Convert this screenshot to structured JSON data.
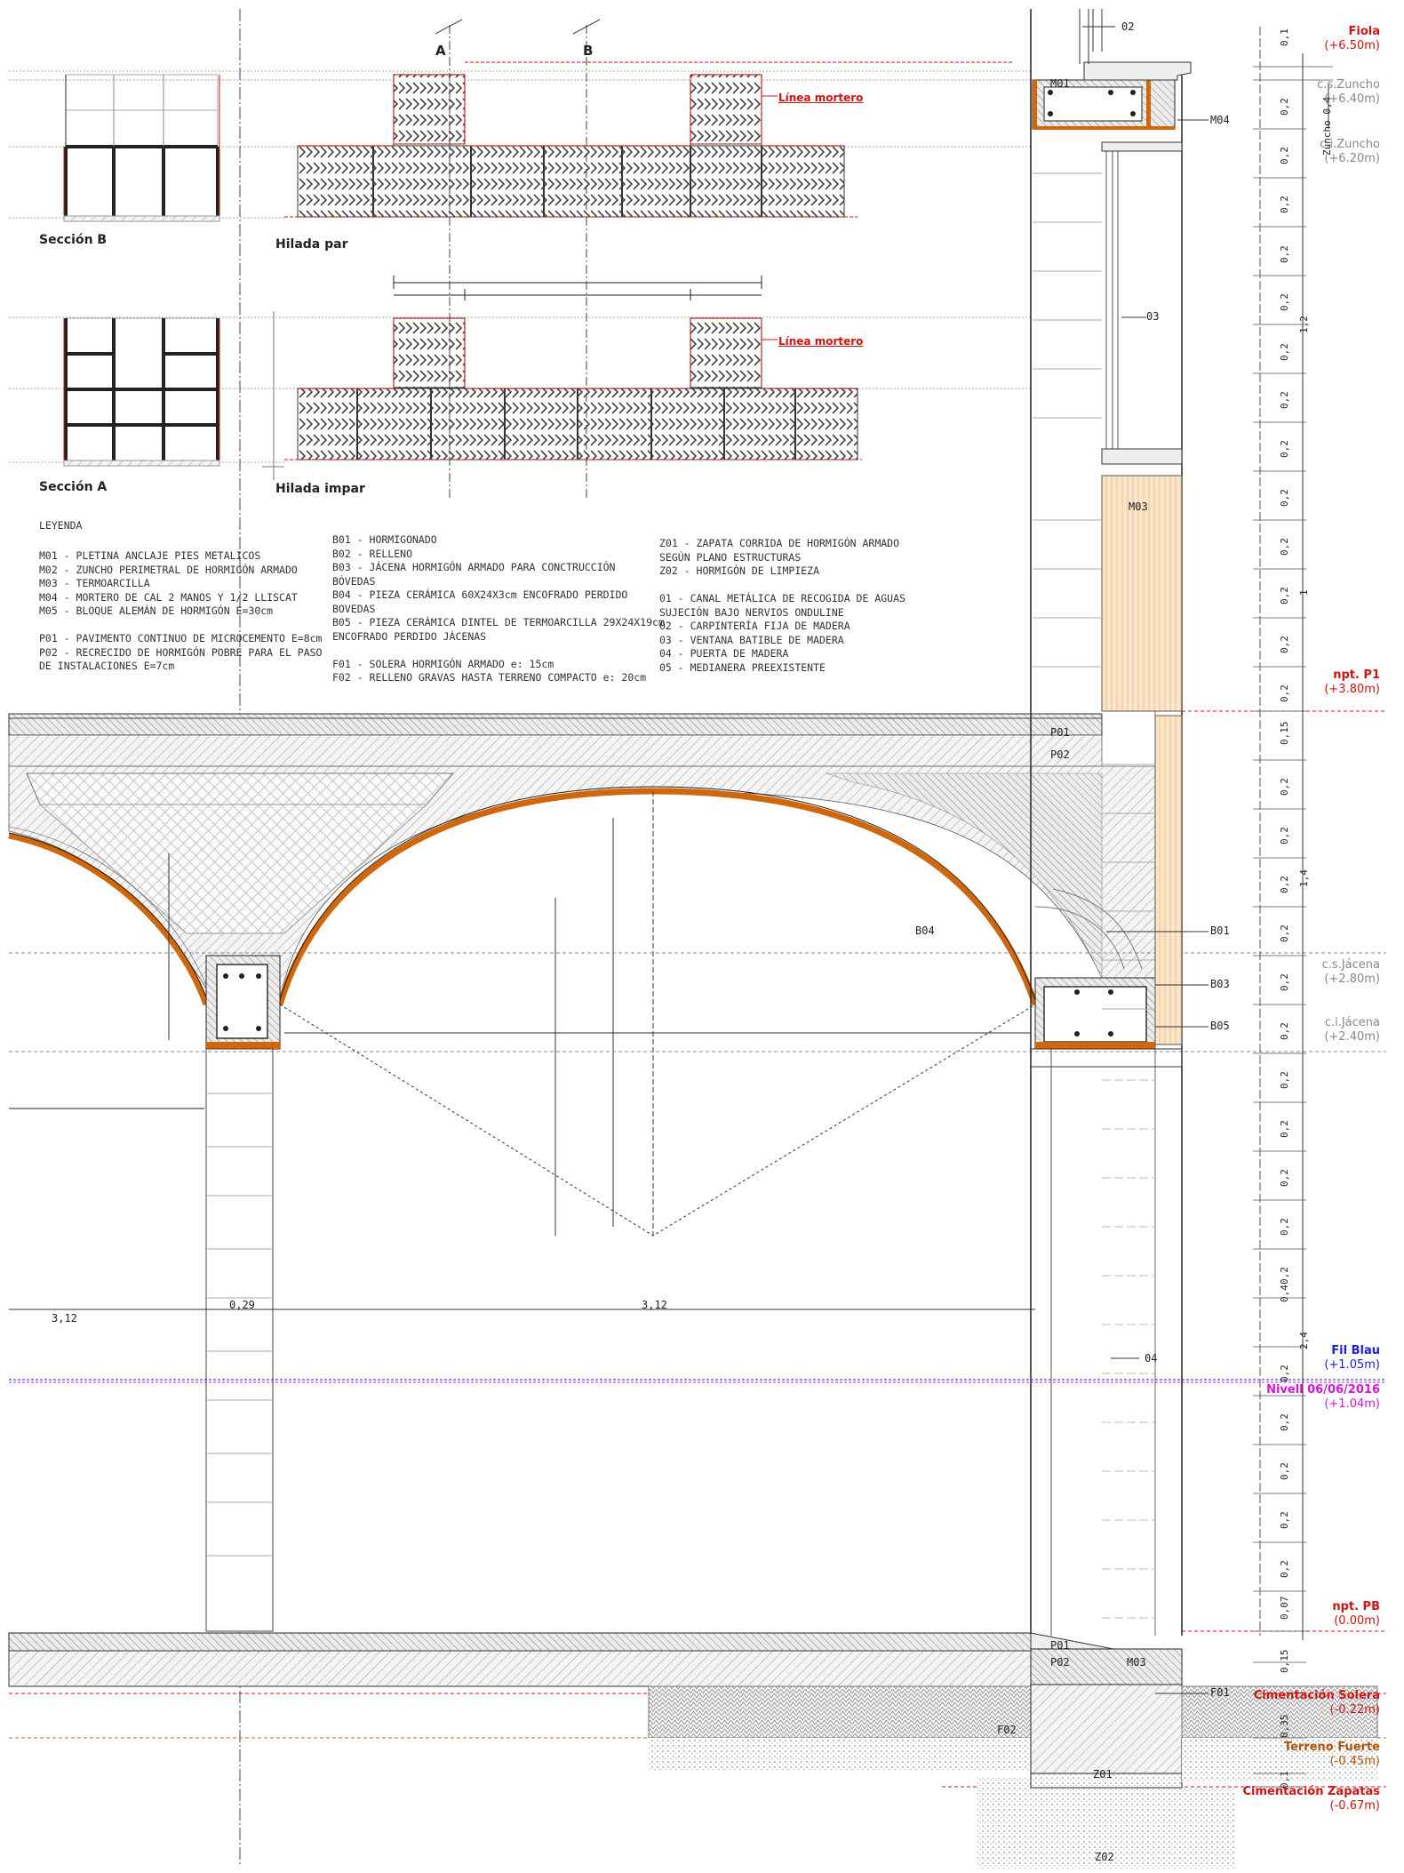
{
  "sections": {
    "sec_b": "Sección B",
    "hilada_par": "Hilada par",
    "sec_a": "Sección A",
    "hilada_impar": "Hilada impar",
    "mark_a": "A",
    "mark_b": "B",
    "mortar_1": "Línea mortero",
    "mortar_2": "Línea mortero"
  },
  "legend": {
    "title": "LEYENDA",
    "col1": [
      "M01 - PLETINA ANCLAJE PIES METALICOS",
      "M02 - ZUNCHO PERIMETRAL DE HORMIGÓN ARMADO",
      "M03 - TERMOARCILLA",
      "M04 - MORTERO DE CAL  2 MANOS Y 1/2 LLISCAT",
      "M05 - BLOQUE ALEMÁN DE HORMIGÓN E=30cm",
      "",
      "P01 - PAVIMENTO CONTINUO DE MICROCEMENTO E=8cm",
      "P02 - RECRECIDO DE HORMIGÓN POBRE PARA EL PASO",
      "DE INSTALACIONES E=7cm"
    ],
    "col2": [
      "B01 - HORMIGONADO",
      "B02 - RELLENO",
      "B03 - JÁCENA HORMIGÓN ARMADO PARA CONCTRUCCIÓN",
      "BÓVEDAS",
      "B04 - PIEZA CERÁMICA 60X24X3cm ENCOFRADO PERDIDO",
      "BOVEDAS",
      "B05 - PIEZA CERÁMICA DINTEL DE TERMOARCILLA 29X24X19cm",
      "ENCOFRADO PERDIDO JÁCENAS",
      "",
      "F01 - SOLERA HORMIGÓN ARMADO e: 15cm",
      "F02 - RELLENO GRAVAS HASTA TERRENO COMPACTO e: 20cm"
    ],
    "col3": [
      "Z01 - ZAPATA CORRIDA DE HORMIGÓN ARMADO",
      "SEGÚN PLANO ESTRUCTURAS",
      "Z02 - HORMIGÓN DE LIMPIEZA",
      "",
      "01 -  CANAL METÁLICA DE RECOGIDA DE AGUAS",
      "SUJECIÓN BAJO NERVIOS ONDULINE",
      "02 - CARPINTERÍA FIJA DE MADERA",
      "03 - VENTANA BATIBLE DE MADERA",
      "04 - PUERTA DE MADERA",
      "05 - MEDIANERA PREEXISTENTE"
    ]
  },
  "levels": [
    {
      "name": "Fiola",
      "value": "(+6.50m)",
      "color": "red"
    },
    {
      "name": "c.s.Zuncho",
      "value": "(+6.40m)",
      "color": "gray"
    },
    {
      "name": "c.i.Zuncho",
      "value": "(+6.20m)",
      "color": "gray"
    },
    {
      "name": "npt. P1",
      "value": "(+3.80m)",
      "color": "red"
    },
    {
      "name": "c.s.Jácena",
      "value": "(+2.80m)",
      "color": "gray"
    },
    {
      "name": "c.i.Jácena",
      "value": "(+2.40m)",
      "color": "gray"
    },
    {
      "name": "Fil Blau",
      "value": "(+1.05m)",
      "color": "blue"
    },
    {
      "name": "Nivell 06/06/2016",
      "value": "(+1.04m)",
      "color": "magenta"
    },
    {
      "name": "npt. PB",
      "value": "(0.00m)",
      "color": "red"
    },
    {
      "name": "Cimentación Solera",
      "value": "(-0.22m)",
      "color": "red"
    },
    {
      "name": "Terreno Fuerte",
      "value": "(-0.45m)",
      "color": "orange"
    },
    {
      "name": "Cimentación Zapatas",
      "value": "(-0.67m)",
      "color": "red"
    }
  ],
  "tags": {
    "t02": "02",
    "m01": "M01",
    "m04": "M04",
    "t03": "03",
    "m03": "M03",
    "p01": "P01",
    "p02": "P02",
    "b04": "B04",
    "b01": "B01",
    "b03": "B03",
    "b05": "B05",
    "t04": "04",
    "p01b": "P01",
    "p02b": "P02",
    "m03b": "M03",
    "f01": "F01",
    "f02": "F02",
    "z01": "Z01",
    "z02": "Z02"
  },
  "dims": {
    "left_span": "3,12",
    "column_w": "0,29",
    "mid_span": "3,12",
    "zuncho_label": "Zuncho 0,4",
    "v_0_1": "0,1",
    "v_0_2": "0,2",
    "v_1_2": "1,2",
    "v_1": "1",
    "v_0_15": "0,15",
    "v_1_4": "1,4",
    "v_0_4": "0,4",
    "v_2_4": "2,4",
    "v_0_07": "0,07",
    "v_0_15b": "0,15",
    "v_0_35": "0,35",
    "v_0_1b": "0,1"
  }
}
